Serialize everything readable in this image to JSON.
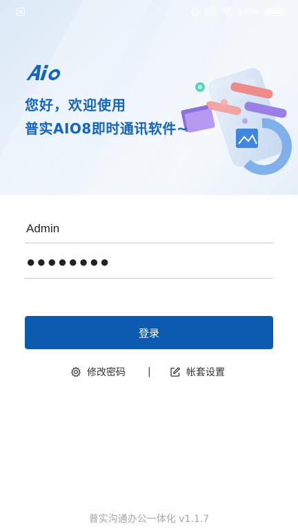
{
  "status_bar": {
    "network_top": "0.90",
    "network_bottom": "KB/s",
    "battery": "100%"
  },
  "hero": {
    "greeting_line1": "您好，欢迎使用",
    "greeting_line2": "普实AIO8即时通讯软件~"
  },
  "login": {
    "username": "Admin",
    "password": "●●●●●●●●",
    "login_label": "登录"
  },
  "links": {
    "change_password": "修改密码",
    "separator": "|",
    "account_settings": "帐套设置"
  },
  "footer": {
    "version": "普实沟通办公一体化 v1.1.7"
  },
  "colors": {
    "accent": "#0c5bb0",
    "greeting": "#1565c0"
  },
  "icons": {
    "logo": "aio-logo",
    "change_password": "gear-icon",
    "account_settings": "edit-icon"
  }
}
